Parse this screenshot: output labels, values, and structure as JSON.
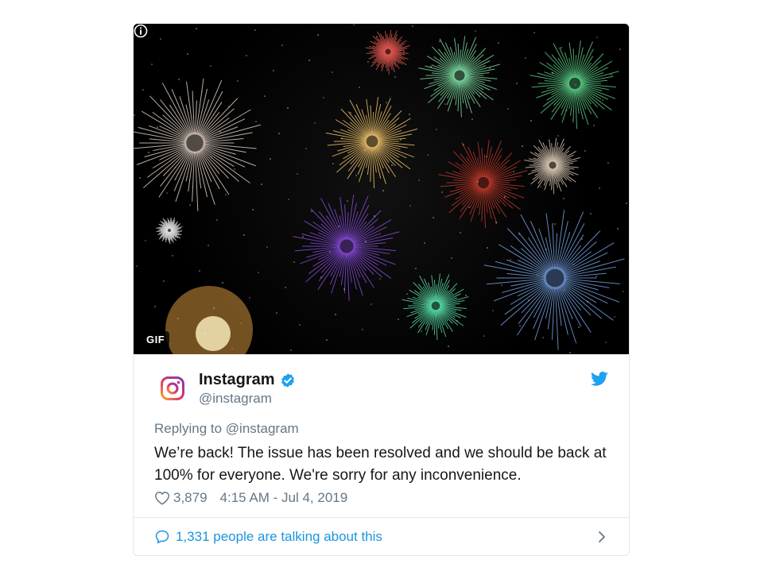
{
  "media": {
    "badge": "GIF",
    "info_icon": "info-circle-icon"
  },
  "author": {
    "name": "Instagram",
    "handle": "@instagram",
    "verified": true,
    "avatar_icon": "instagram-logo-icon"
  },
  "tweet": {
    "reply_prefix": "Replying to",
    "reply_mention": "@instagram",
    "text": "We’re back! The issue has been resolved and we should be back at 100% for everyone. We're sorry for any inconvenience.",
    "likes": "3,879",
    "timestamp": "4:15 AM - Jul 4, 2019"
  },
  "footer": {
    "conversation_text": "1,331 people are talking about this"
  },
  "colors": {
    "link": "#1b95e0",
    "muted": "#657786",
    "text": "#14171a",
    "border": "#e1e8ed",
    "twitter_blue": "#1da1f2"
  }
}
